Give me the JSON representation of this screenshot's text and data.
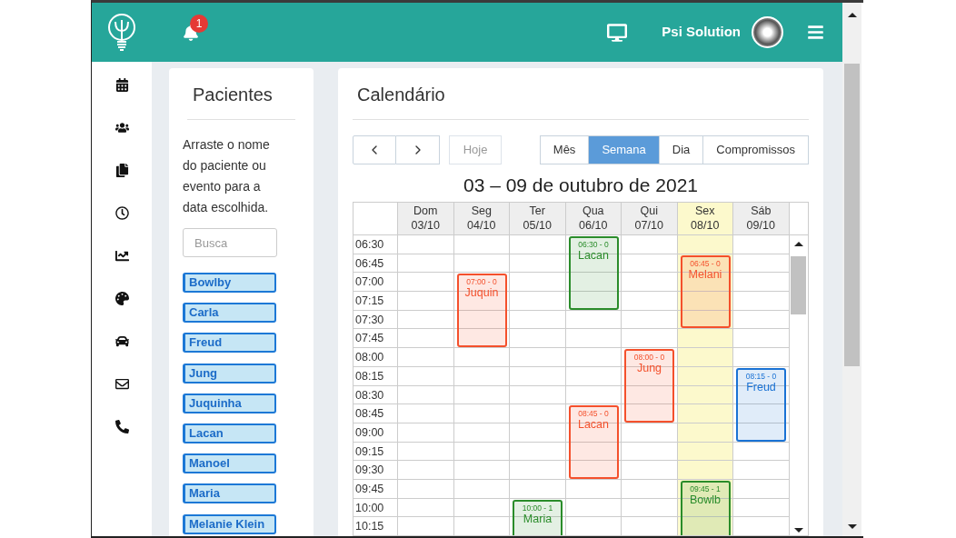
{
  "header": {
    "notification_count": "1",
    "user_name": "Psi Solution"
  },
  "patients": {
    "title": "Pacientes",
    "instructions": "Arraste o nome do paciente ou evento para a data escolhida.",
    "search": {
      "placeholder": "Busca"
    },
    "items": [
      "Bowlby",
      "Carla",
      "Freud",
      "Jung",
      "Juquinha",
      "Lacan",
      "Manoel",
      "Maria",
      "Melanie Klein"
    ]
  },
  "calendar": {
    "title": "Calendário",
    "today_button": {
      "label": "Hoje",
      "disabled": true
    },
    "views": [
      {
        "label": "Mês",
        "selected": false
      },
      {
        "label": "Semana",
        "selected": true
      },
      {
        "label": "Dia",
        "selected": false
      },
      {
        "label": "Compromissos",
        "selected": false
      }
    ],
    "range_title": "03 – 09 de outubro de 2021",
    "times": [
      "06:30",
      "06:45",
      "07:00",
      "07:15",
      "07:30",
      "07:45",
      "08:00",
      "08:15",
      "08:30",
      "08:45",
      "09:00",
      "09:15",
      "09:30",
      "09:45",
      "10:00",
      "10:15"
    ],
    "days": [
      {
        "weekday": "Dom",
        "date": "03/10",
        "today": false
      },
      {
        "weekday": "Seg",
        "date": "04/10",
        "today": false,
        "events": [
          {
            "time": "07:00 - 0",
            "name": "Juquin",
            "color": "#f4502c"
          }
        ]
      },
      {
        "weekday": "Ter",
        "date": "05/10",
        "today": false,
        "events": [
          {
            "time": "10:00 - 1",
            "name": "Maria",
            "color": "#2a8c2a"
          }
        ]
      },
      {
        "weekday": "Qua",
        "date": "06/10",
        "today": false,
        "events": [
          {
            "time": "06:30 - 0",
            "name": "Lacan",
            "color": "#2a8c2a"
          },
          {
            "time": "08:45 - 0",
            "name": "Lacan",
            "color": "#f4502c"
          }
        ]
      },
      {
        "weekday": "Qui",
        "date": "07/10",
        "today": false,
        "events": [
          {
            "time": "08:00 - 0",
            "name": "Jung",
            "color": "#f4502c"
          }
        ]
      },
      {
        "weekday": "Sex",
        "date": "08/10",
        "today": true,
        "events": [
          {
            "time": "06:45 - 0",
            "name": "Melani",
            "color": "#f4502c"
          },
          {
            "time": "09:45 - 1",
            "name": "Bowlb",
            "color": "#2a8c2a"
          }
        ]
      },
      {
        "weekday": "Sáb",
        "date": "09/10",
        "today": false,
        "events": [
          {
            "time": "08:15 - 0",
            "name": "Freud",
            "color": "#1a72d4"
          }
        ]
      }
    ]
  }
}
